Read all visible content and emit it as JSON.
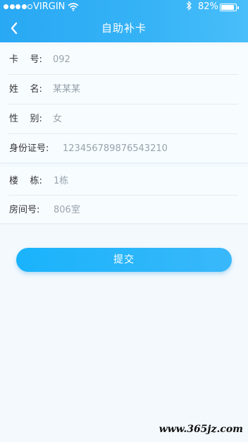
{
  "status_bar": {
    "carrier": "VIRGIN",
    "battery": "82%",
    "battery_level": 0.82,
    "signal_bars_filled": 4,
    "signal_bars_total": 5,
    "icons": [
      "signal-dots-icon",
      "wifi-icon",
      "bluetooth-icon",
      "battery-icon"
    ]
  },
  "nav": {
    "title": "自助补卡",
    "back_icon": "chevron-left-icon"
  },
  "form": {
    "card_no": {
      "label": "卡    号:",
      "value": "092"
    },
    "name": {
      "label": "姓    名:",
      "value": "某某某"
    },
    "gender": {
      "label": "性    别:",
      "value": "女"
    },
    "id_no": {
      "label": "身份证号:",
      "value": "123456789876543210"
    },
    "building": {
      "label": "楼    栋:",
      "value": "1栋"
    },
    "room": {
      "label": "房间号:",
      "value": "806室"
    }
  },
  "submit_label": "提交",
  "watermark": "www.365jz.com",
  "colors": {
    "header": "#2fadf5",
    "background": "#f3f9fd",
    "button": "#1ab3fb",
    "label_text": "#333333",
    "value_text": "#9aa4ad"
  }
}
